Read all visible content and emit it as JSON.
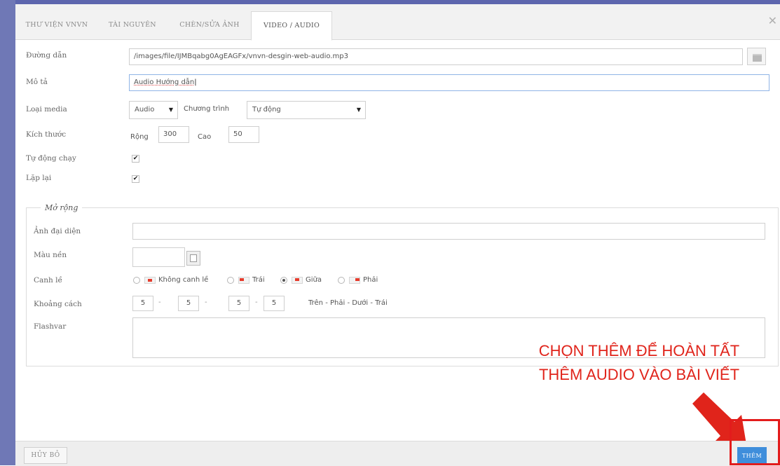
{
  "tabs": [
    {
      "label": "THƯ VIỆN VNVN"
    },
    {
      "label": "TÀI NGUYÊN"
    },
    {
      "label": "CHÈN/SỬA ẢNH"
    },
    {
      "label": "VIDEO / AUDIO",
      "active": true
    }
  ],
  "close_symbol": "✕",
  "form": {
    "path_label": "Đường dẫn",
    "path_value": "/images/file/IJMBqabg0AgEAGFx/vnvn-desgin-web-audio.mp3",
    "desc_label": "Mô tả",
    "desc_value": "Audio Hướng  dẫn",
    "media_label": "Loại media",
    "media_value": "Audio",
    "program_label": "Chương trình",
    "program_value": "Tự động",
    "size_label": "Kích thước",
    "width_label": "Rộng",
    "width_value": "300",
    "height_label": "Cao",
    "height_value": "50",
    "autoplay_label": "Tự động chạy",
    "autoplay_checked": true,
    "loop_label": "Lặp lại",
    "loop_checked": true
  },
  "extended": {
    "legend": "Mở rộng",
    "thumb_label": "Ảnh đại diện",
    "thumb_value": "",
    "bg_label": "Màu nền",
    "align_label": "Canh lề",
    "align_options": [
      "Không canh lề",
      "Trái",
      "Giữa",
      "Phải"
    ],
    "align_selected": "Giữa",
    "spacing_label": "Khoảng cách",
    "spacing_values": [
      "5",
      "5",
      "5",
      "5"
    ],
    "spacing_hint": "Trên - Phải - Dưới - Trái",
    "flashvar_label": "Flashvar",
    "flashvar_value": ""
  },
  "footer": {
    "cancel_label": "HỦY BỎ",
    "add_label": "THÊM"
  },
  "annotation": {
    "line1": "CHỌN THÊM ĐỂ HOÀN TẤT",
    "line2": "THÊM AUDIO VÀO BÀI VIẾT"
  },
  "colors": {
    "accent": "#3f8edb",
    "annotation": "#e0241b",
    "frame": "#6f78b6"
  }
}
